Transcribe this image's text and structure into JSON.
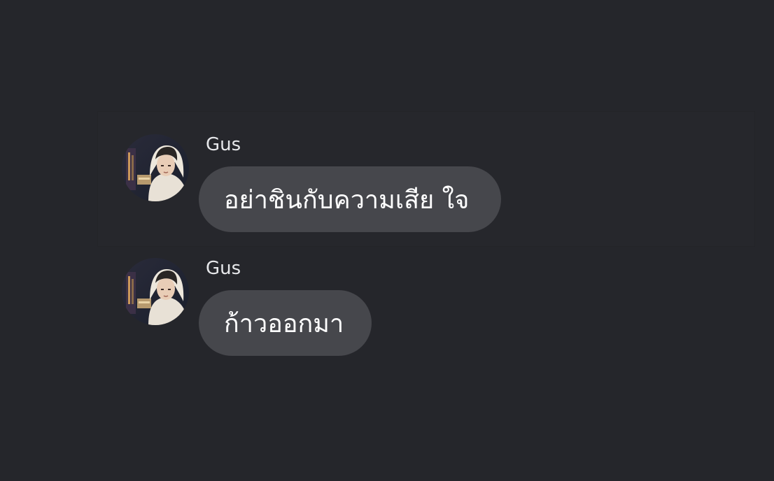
{
  "messages": [
    {
      "sender": "Gus",
      "text": "อย่าชินกับความเสีย ใจ"
    },
    {
      "sender": "Gus",
      "text": "ก้าวออกมา"
    }
  ],
  "colors": {
    "background": "#25262b",
    "bubble": "#46474c",
    "sender_text": "#e6e7ea",
    "message_text": "#ffffff"
  }
}
